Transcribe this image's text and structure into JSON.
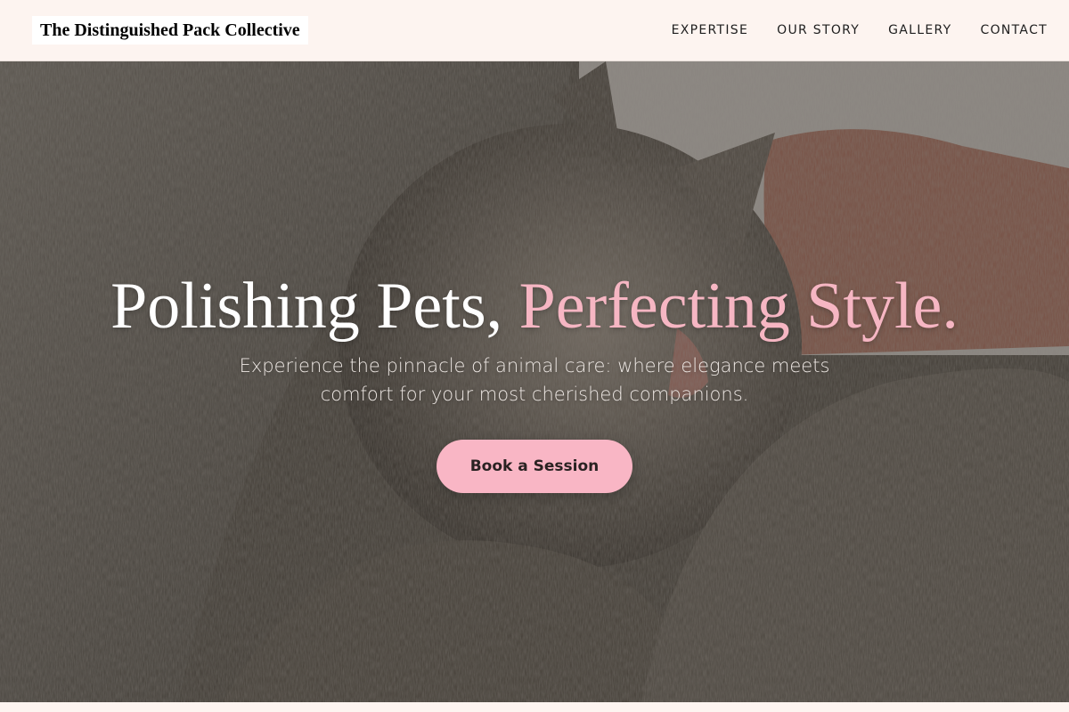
{
  "site": {
    "brand": "The Distinguished Pack Collective"
  },
  "nav": {
    "items": [
      {
        "label": "EXPERTISE"
      },
      {
        "label": "OUR STORY"
      },
      {
        "label": "GALLERY"
      },
      {
        "label": "CONTACT"
      }
    ]
  },
  "hero": {
    "title_main": "Polishing Pets, ",
    "title_accent": "Perfecting Style.",
    "subtitle": "Experience the pinnacle of animal care: where elegance meets comfort for your most cherished companions.",
    "cta_label": "Book a Session",
    "background_image": "two tabby cats cuddling"
  },
  "colors": {
    "nav_background": "#fdf4f0",
    "accent_pink": "#f6b6c3",
    "button_pink": "#f9b6c5",
    "text_dark": "#1e1e1e"
  }
}
